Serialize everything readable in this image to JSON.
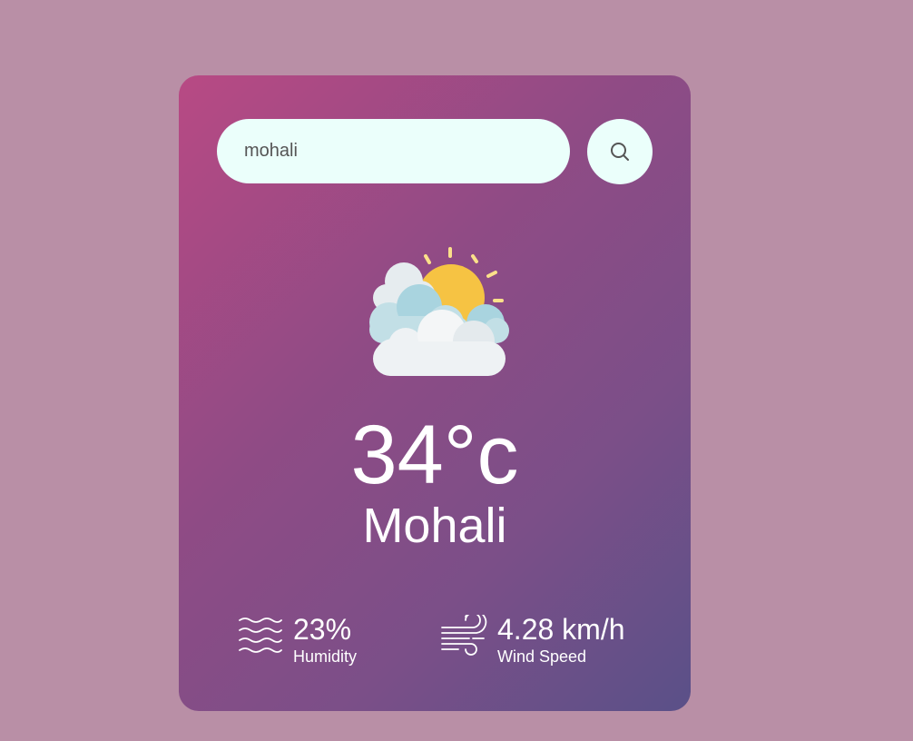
{
  "colors": {
    "page_background": "#b98fa6",
    "card_gradient_start": "#b84a84",
    "card_gradient_end": "#5a5088",
    "input_background": "#ebfffb",
    "text": "#ffffff"
  },
  "search": {
    "value": "mohali",
    "button_icon": "search-icon"
  },
  "weather": {
    "icon": "sun-behind-clouds-icon",
    "temperature": "34°c",
    "city": "Mohali"
  },
  "stats": {
    "humidity": {
      "icon": "humidity-waves-icon",
      "value": "23%",
      "label": "Humidity"
    },
    "wind": {
      "icon": "wind-icon",
      "value": "4.28 km/h",
      "label": "Wind Speed"
    }
  }
}
